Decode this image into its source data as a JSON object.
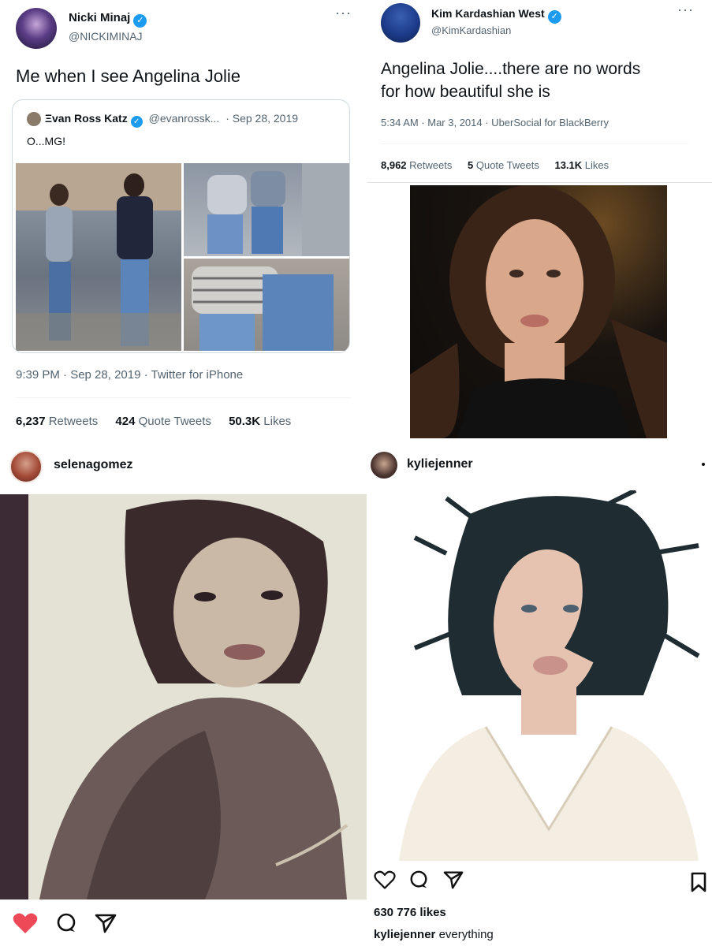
{
  "nicki_tweet": {
    "author_name": "Nicki Minaj",
    "handle": "@NICKIMINAJ",
    "more": "···",
    "text": "Me when I see Angelina Jolie",
    "quote": {
      "author_name": "Ξvan Ross Katz",
      "handle": "@evanrossk...",
      "date": "· Sep 28, 2019",
      "text": "O...MG!"
    },
    "meta": "9:39 PM · Sep 28, 2019 · Twitter for iPhone",
    "stats": {
      "retweets_count": "6,237",
      "retweets_label": "Retweets",
      "quotes_count": "424",
      "quotes_label": "Quote Tweets",
      "likes_count": "50.3K",
      "likes_label": "Likes"
    }
  },
  "kim_tweet": {
    "author_name": "Kim Kardashian West",
    "handle": "@KimKardashian",
    "more": "···",
    "text_line1": "Angelina Jolie....there are no words",
    "text_line2": "for how beautiful she is",
    "meta": "5:34 AM · Mar 3, 2014 · UberSocial for BlackBerry",
    "stats": {
      "retweets_count": "8,962",
      "retweets_label": "Retweets",
      "quotes_count": "5",
      "quotes_label": "Quote Tweets",
      "likes_count": "13.1K",
      "likes_label": "Likes"
    }
  },
  "selena_post": {
    "username": "selenagomez",
    "liked": true
  },
  "kylie_post": {
    "username": "kyliejenner",
    "likes": "630 776 likes",
    "caption_user": "kyliejenner",
    "caption_text": "everything"
  },
  "colors": {
    "twitter_blue": "#1d9bf0",
    "like_red": "#ed4956",
    "text": "#0f1419",
    "muted": "#536471"
  }
}
